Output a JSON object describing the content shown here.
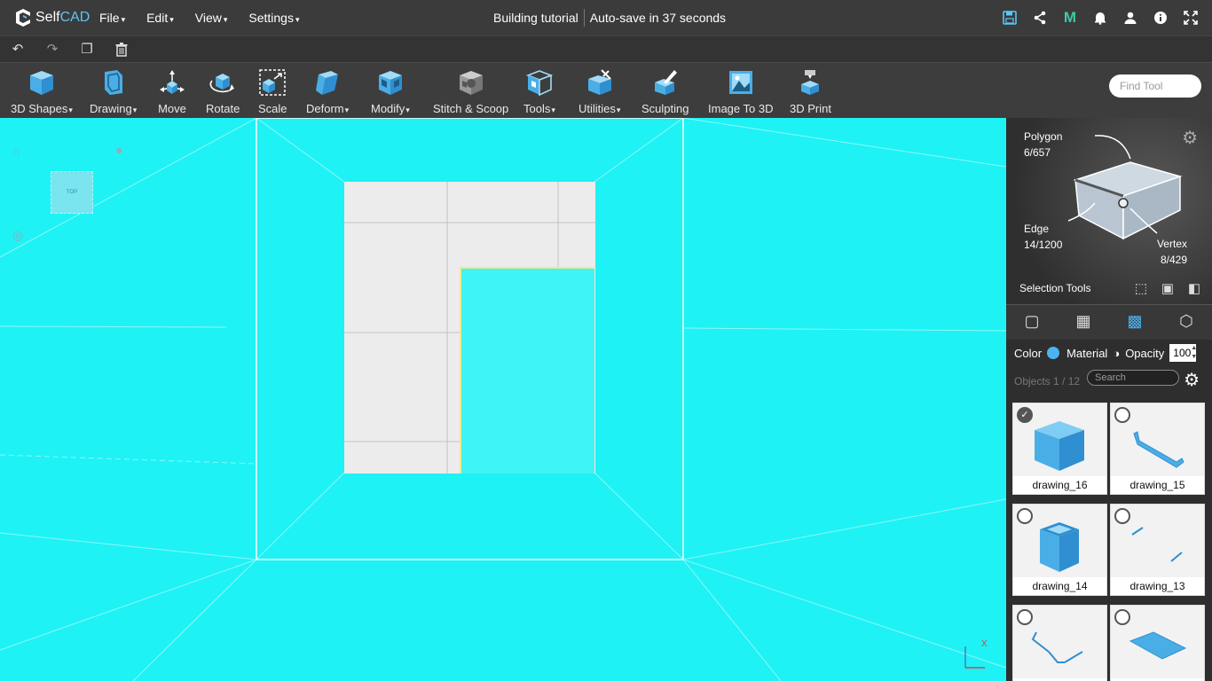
{
  "app": {
    "logo_prefix": "Self",
    "logo_suffix": "CAD",
    "title": "Building tutorial",
    "autosave": "Auto-save in 37 seconds",
    "menus": [
      "File",
      "Edit",
      "View",
      "Settings"
    ]
  },
  "top_icons": [
    "save-icon",
    "share-icon",
    "m-icon",
    "bell-icon",
    "user-icon",
    "info-icon",
    "fullscreen-icon"
  ],
  "edit_icons": [
    "undo-icon",
    "redo-icon",
    "copy-icon",
    "delete-icon"
  ],
  "toolbar": {
    "tools": [
      {
        "label": "3D Shapes",
        "dropdown": true,
        "icon": "cube-icon"
      },
      {
        "label": "Drawing",
        "dropdown": true,
        "icon": "drawing-icon"
      },
      {
        "label": "Move",
        "dropdown": false,
        "icon": "move-icon"
      },
      {
        "label": "Rotate",
        "dropdown": false,
        "icon": "rotate-icon"
      },
      {
        "label": "Scale",
        "dropdown": false,
        "icon": "scale-icon"
      },
      {
        "label": "Deform",
        "dropdown": true,
        "icon": "deform-icon"
      },
      {
        "label": "Modify",
        "dropdown": true,
        "icon": "modify-icon"
      },
      {
        "label": "Stitch & Scoop",
        "dropdown": false,
        "icon": "stitch-scoop-icon"
      },
      {
        "label": "Tools",
        "dropdown": true,
        "icon": "tools-icon"
      },
      {
        "label": "Utilities",
        "dropdown": true,
        "icon": "utilities-icon"
      },
      {
        "label": "Sculpting",
        "dropdown": false,
        "icon": "sculpting-icon"
      },
      {
        "label": "Image To 3D",
        "dropdown": false,
        "icon": "image-to-3d-icon"
      },
      {
        "label": "3D Print",
        "dropdown": false,
        "icon": "3d-print-icon"
      }
    ],
    "find_placeholder": "Find Tool"
  },
  "viewport": {
    "nav_cube_label": "TOP"
  },
  "selection": {
    "polygon_label": "Polygon",
    "polygon_count": "6/657",
    "edge_label": "Edge",
    "edge_count": "14/1200",
    "vertex_label": "Vertex",
    "vertex_count": "8/429",
    "tools_label": "Selection Tools"
  },
  "properties": {
    "color_label": "Color",
    "color": "#4ab4f0",
    "material_label": "Material",
    "opacity_label": "Opacity",
    "opacity_value": "100"
  },
  "objects": {
    "header": "Objects 1 / 12",
    "search_placeholder": "Search",
    "items": [
      {
        "name": "drawing_16",
        "selected": true
      },
      {
        "name": "drawing_15",
        "selected": false
      },
      {
        "name": "drawing_14",
        "selected": false
      },
      {
        "name": "drawing_13",
        "selected": false
      },
      {
        "name": "",
        "selected": false
      },
      {
        "name": "",
        "selected": false
      }
    ]
  }
}
